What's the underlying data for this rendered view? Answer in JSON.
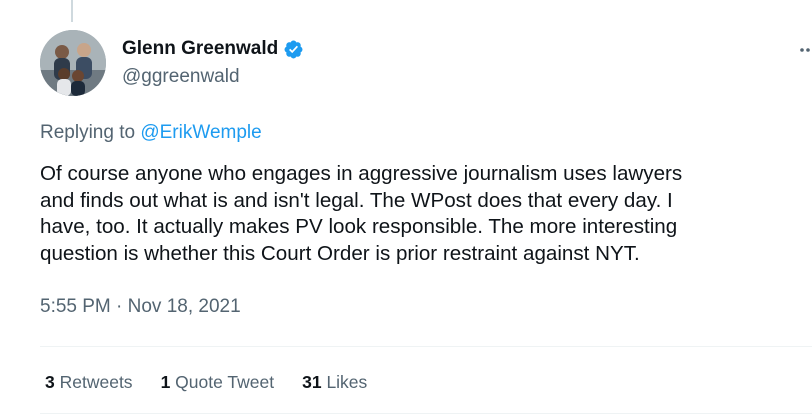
{
  "author": {
    "display_name": "Glenn Greenwald",
    "handle": "@ggreenwald",
    "verified_icon": "verified-badge-icon",
    "verified_color": "#1d9bf0"
  },
  "reply": {
    "prefix": "Replying to",
    "to_handle": "@ErikWemple"
  },
  "tweet": {
    "text": "Of course anyone who engages in aggressive journalism uses lawyers\nand finds out what is and isn't legal. The WPost does that every day. I\nhave, too. It actually makes PV look responsible. The more interesting\nquestion is whether this Court Order is prior restraint against NYT.",
    "timestamp": "5:55 PM · Nov 18, 2021"
  },
  "stats": {
    "retweets_count": "3",
    "retweets_label": "Retweets",
    "quote_count": "1",
    "quote_label": "Quote Tweet",
    "likes_count": "31",
    "likes_label": "Likes"
  },
  "colors": {
    "link": "#1d9bf0",
    "secondary_text": "#536471",
    "primary_text": "#0f1419",
    "divider": "#eff3f4"
  }
}
